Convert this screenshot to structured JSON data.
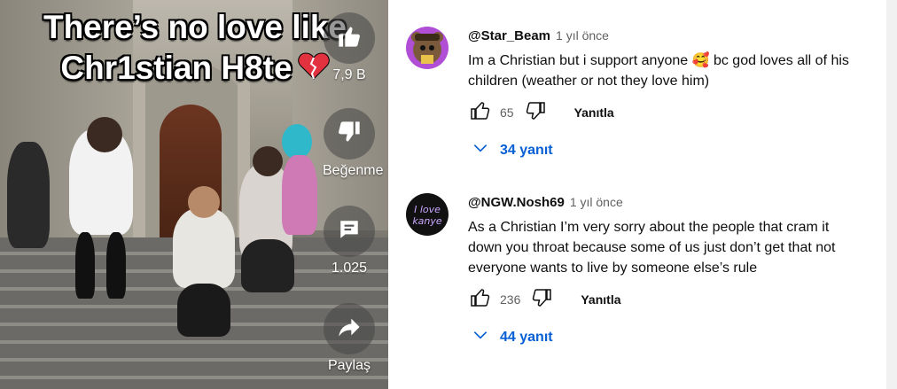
{
  "video": {
    "title_line1": "There’s no love like",
    "title_line2": "Chr1stian H8te",
    "actions": {
      "like_count": "7,9 B",
      "dislike_label": "Beğenme",
      "comment_count": "1.025",
      "share_label": "Paylaş"
    }
  },
  "comments": [
    {
      "handle": "@Star_Beam",
      "time": "1 yıl önce",
      "text": "Im a Christian but i support anyone 🥰 bc god loves all of his children (weather or not they love him)",
      "likes": "65",
      "reply_label": "Yanıtla",
      "replies_label": "34 yanıt",
      "avatar_icon": "bear-avatar"
    },
    {
      "handle": "@NGW.Nosh69",
      "time": "1 yıl önce",
      "text": "As a Christian I’m very sorry about the people that cram it down you throat because some of us just don’t get that not everyone wants to live by someone else’s rule",
      "likes": "236",
      "reply_label": "Yanıtla",
      "replies_label": "44 yanıt",
      "avatar_icon": "i-love-kanye-avatar",
      "avatar_text": "I love kanye"
    }
  ],
  "colors": {
    "link_blue": "#065fd4",
    "text_primary": "#0f0f0f",
    "text_secondary": "#606060"
  }
}
